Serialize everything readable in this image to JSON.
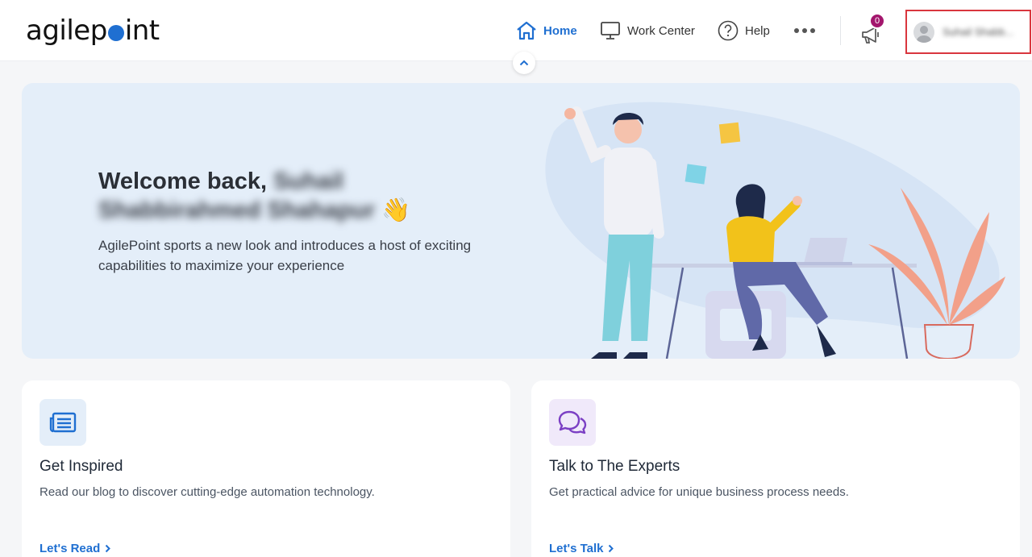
{
  "brand": {
    "logo_left": "agilep",
    "logo_right": "int"
  },
  "nav": {
    "home": "Home",
    "work_center": "Work Center",
    "help": "Help"
  },
  "notifications": {
    "count": "0"
  },
  "user": {
    "name": "Suhail Shabb..."
  },
  "hero": {
    "title_prefix": "Welcome back,",
    "title_name": "Suhail Shabbirahmed Shahapur",
    "wave": "👋",
    "subtitle": "AgilePoint sports a new look and introduces a host of exciting capabilities to maximize your experience"
  },
  "cards": [
    {
      "title": "Get Inspired",
      "desc": "Read our blog to discover cutting-edge automation technology.",
      "link": "Let's Read"
    },
    {
      "title": "Talk to The Experts",
      "desc": "Get practical advice for unique business process needs.",
      "link": "Let's Talk"
    }
  ],
  "colors": {
    "accent": "#1f6fd1",
    "hero_bg": "#e4eef9",
    "badge": "#a3166d",
    "highlight_border": "#d9363e"
  }
}
